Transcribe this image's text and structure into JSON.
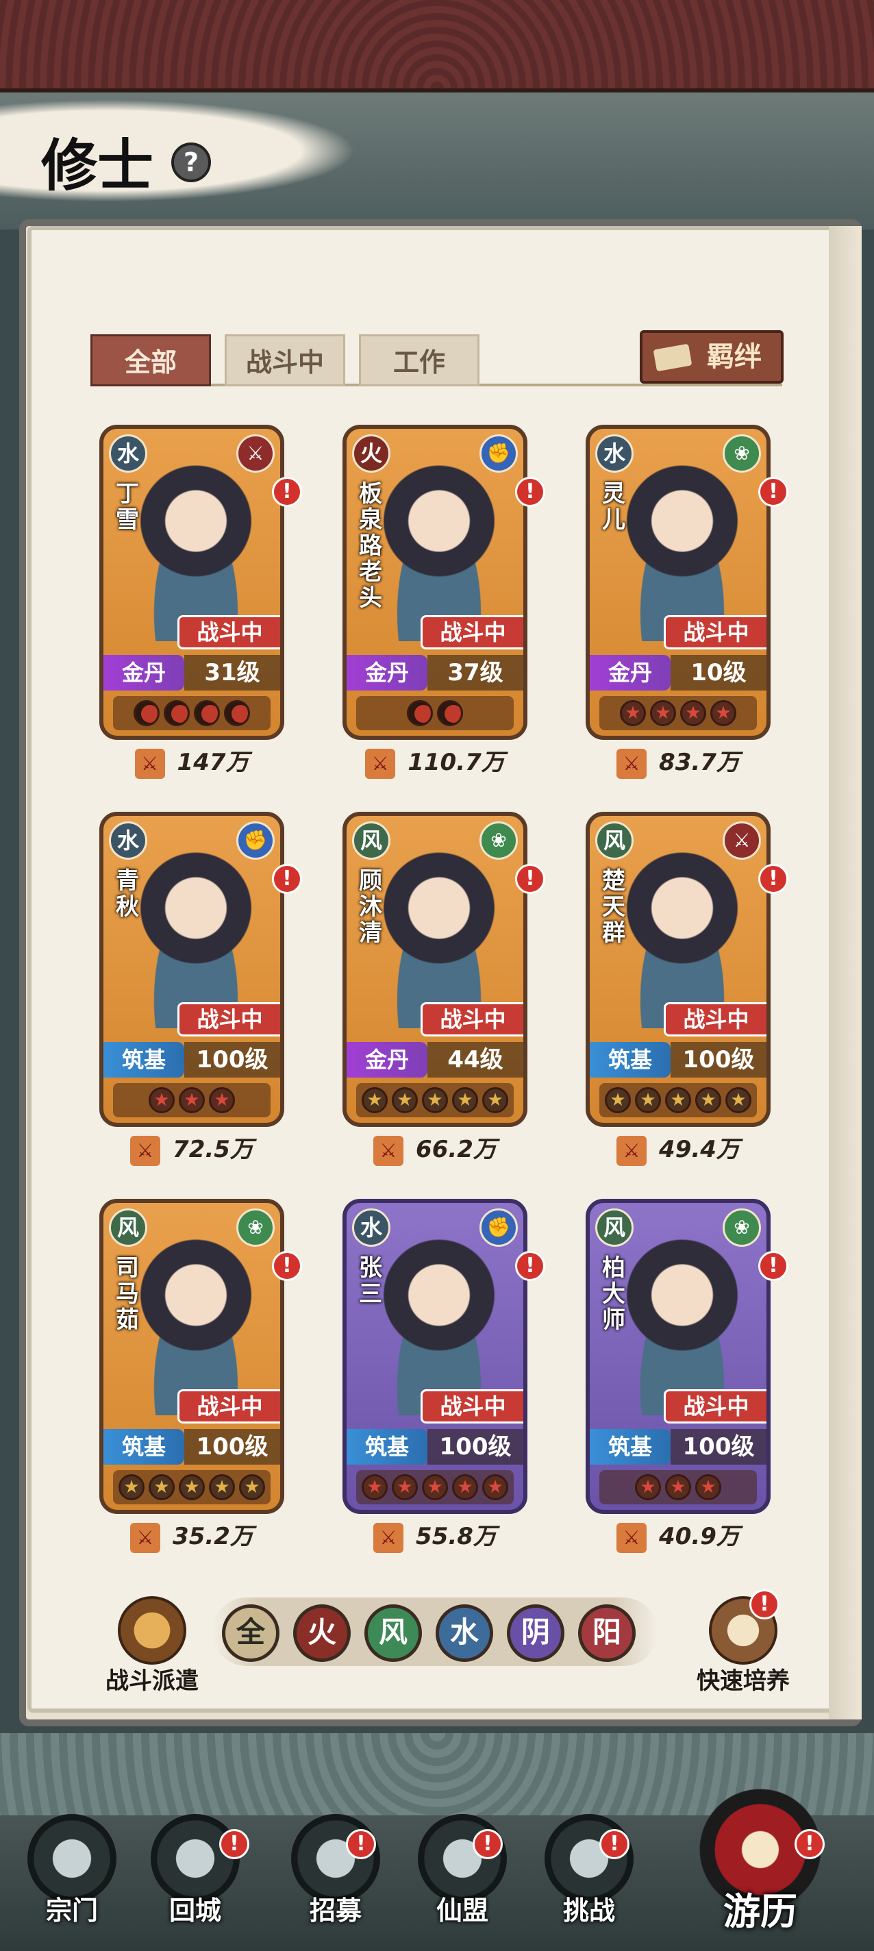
{
  "header": {
    "title": "修士",
    "help": "?"
  },
  "tabs": [
    {
      "label": "全部",
      "active": true
    },
    {
      "label": "战斗中",
      "active": false
    },
    {
      "label": "工作",
      "active": false
    }
  ],
  "bond_button": "羁绊",
  "cards": [
    {
      "element": "水",
      "role": "sword-icon",
      "name": "丁雪",
      "status": "战斗中",
      "realm": "金丹",
      "level": "31级",
      "grade": "moon",
      "count": 4,
      "power": "147万",
      "frame": "orange"
    },
    {
      "element": "火",
      "role": "fist-icon",
      "name": "板泉路老头",
      "status": "战斗中",
      "realm": "金丹",
      "level": "37级",
      "grade": "moon",
      "count": 2,
      "power": "110.7万",
      "frame": "orange"
    },
    {
      "element": "水",
      "role": "fan-icon",
      "name": "灵儿",
      "status": "战斗中",
      "realm": "金丹",
      "level": "10级",
      "grade": "red-star",
      "count": 4,
      "power": "83.7万",
      "frame": "orange"
    },
    {
      "element": "水",
      "role": "fist-icon",
      "name": "青秋",
      "status": "战斗中",
      "realm": "筑基",
      "level": "100级",
      "grade": "red-star",
      "count": 3,
      "power": "72.5万",
      "frame": "orange"
    },
    {
      "element": "风",
      "role": "fan-icon",
      "name": "顾沐清",
      "status": "战斗中",
      "realm": "金丹",
      "level": "44级",
      "grade": "gold-star",
      "count": 5,
      "power": "66.2万",
      "frame": "orange"
    },
    {
      "element": "风",
      "role": "sword-icon",
      "name": "楚天群",
      "status": "战斗中",
      "realm": "筑基",
      "level": "100级",
      "grade": "gold-star",
      "count": 5,
      "power": "49.4万",
      "frame": "orange"
    },
    {
      "element": "风",
      "role": "fan-icon",
      "name": "司马茹",
      "status": "战斗中",
      "realm": "筑基",
      "level": "100级",
      "grade": "gold-star",
      "count": 5,
      "power": "35.2万",
      "frame": "orange"
    },
    {
      "element": "水",
      "role": "fist-icon",
      "name": "张三",
      "status": "战斗中",
      "realm": "筑基",
      "level": "100级",
      "grade": "red-star",
      "count": 5,
      "power": "55.8万",
      "frame": "purple"
    },
    {
      "element": "风",
      "role": "fan-icon",
      "name": "柏大师",
      "status": "战斗中",
      "realm": "筑基",
      "level": "100级",
      "grade": "red-star",
      "count": 3,
      "power": "40.9万",
      "frame": "purple"
    }
  ],
  "dispatch": "战斗派遣",
  "filters": [
    "全",
    "火",
    "风",
    "水",
    "阴",
    "阳"
  ],
  "filter_colors": [
    "#c9b891",
    "#8a2e28",
    "#3e8a56",
    "#3d6b9a",
    "#6a4fa6",
    "#a33a3f"
  ],
  "quick": "快速培养",
  "nav": [
    {
      "label": "宗门",
      "alert": false
    },
    {
      "label": "回城",
      "alert": true
    },
    {
      "label": "招募",
      "alert": true
    },
    {
      "label": "仙盟",
      "alert": true
    },
    {
      "label": "挑战",
      "alert": true
    }
  ],
  "travel": "游历",
  "alert_mark": "!"
}
